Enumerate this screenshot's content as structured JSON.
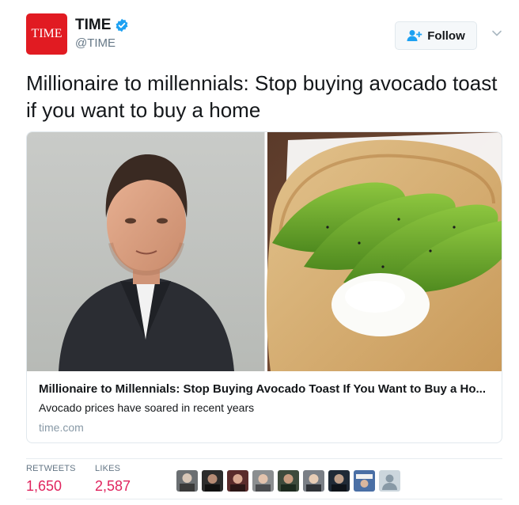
{
  "account": {
    "logo_text": "TIME",
    "display_name": "TIME",
    "handle": "@TIME",
    "verified": true
  },
  "actions": {
    "follow_label": "Follow"
  },
  "tweet": {
    "text": "Millionaire to millennials: Stop buying avocado toast if you want to buy a home"
  },
  "card": {
    "title": "Millionaire to Millennials: Stop Buying Avocado Toast If You Want to Buy a Ho...",
    "description": "Avocado prices have soared in recent years",
    "domain": "time.com"
  },
  "stats": {
    "retweets_label": "RETWEETS",
    "retweets_value": "1,650",
    "likes_label": "LIKES",
    "likes_value": "2,587"
  },
  "colors": {
    "brand": "#e11b22",
    "likes": "#e0245e",
    "verified": "#1da1f2"
  }
}
